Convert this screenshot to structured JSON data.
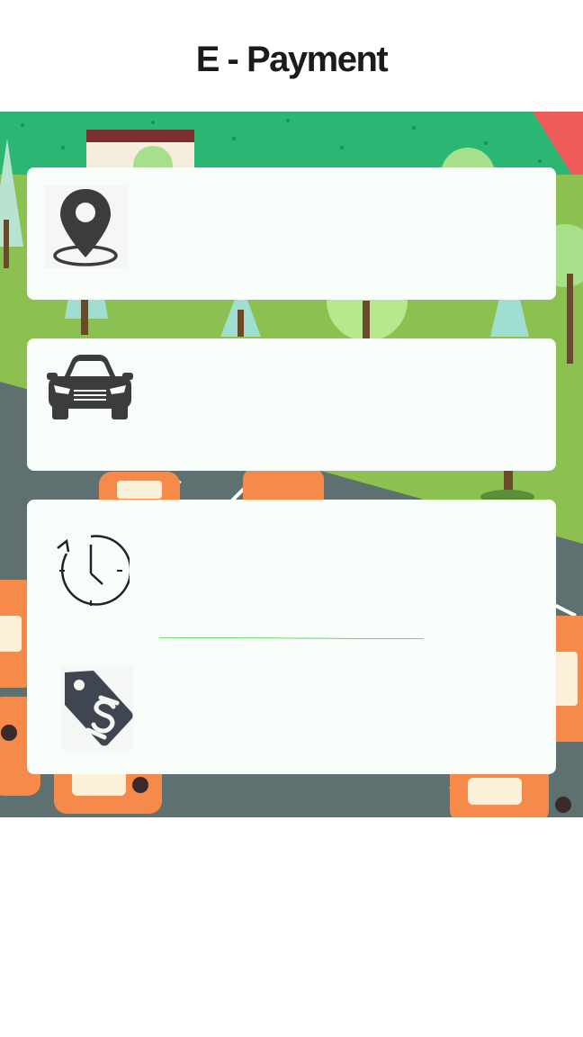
{
  "header": {
    "title": "E - Payment"
  },
  "cards": [
    {
      "id": "location",
      "icon": "location-pin-icon"
    },
    {
      "id": "vehicle",
      "icon": "car-icon"
    },
    {
      "id": "parking-time",
      "icon": "clock-history-icon"
    },
    {
      "id": "price",
      "icon": "price-tag-dollar-icon"
    }
  ],
  "colors": {
    "background": "#ffffff",
    "card": "#f8fdf9",
    "title": "#1b1b1b",
    "icon": "#3c3c3c",
    "divider": "#33cc33",
    "grass_dark": "#2bb673",
    "grass_light": "#8cc152",
    "road": "#5e7070",
    "car_orange": "#f68a4a"
  }
}
